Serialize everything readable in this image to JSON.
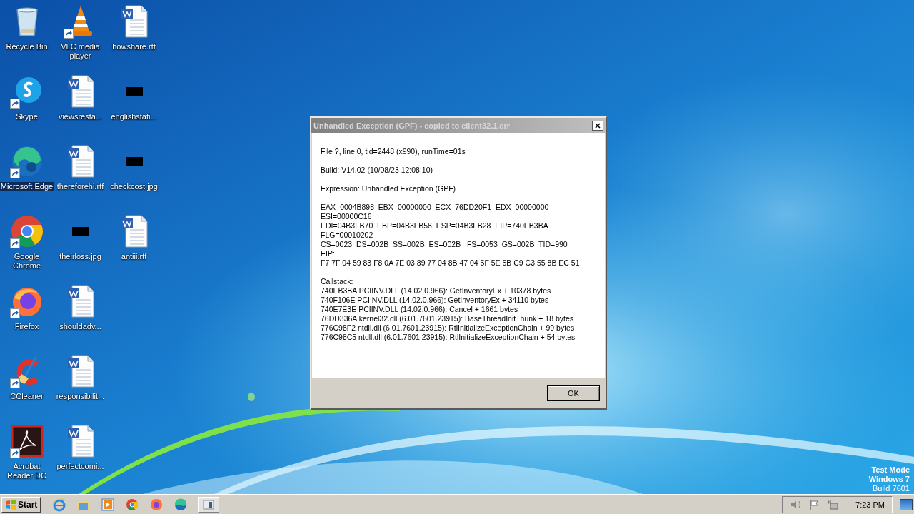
{
  "desktop_icons": [
    {
      "label": "Recycle Bin",
      "kind": "recycle",
      "shortcut": false,
      "selected": false
    },
    {
      "label": "Skype",
      "kind": "skype",
      "shortcut": true,
      "selected": false
    },
    {
      "label": "Microsoft Edge",
      "kind": "edge",
      "shortcut": true,
      "selected": true
    },
    {
      "label": "Google Chrome",
      "kind": "chrome",
      "shortcut": true,
      "selected": false
    },
    {
      "label": "Firefox",
      "kind": "firefox",
      "shortcut": true,
      "selected": false
    },
    {
      "label": "CCleaner",
      "kind": "ccleaner",
      "shortcut": true,
      "selected": false
    },
    {
      "label": "Acrobat Reader DC",
      "kind": "acrobat",
      "shortcut": true,
      "selected": false
    },
    {
      "label": "VLC media player",
      "kind": "vlc",
      "shortcut": true,
      "selected": false
    },
    {
      "label": "viewsresta...",
      "kind": "word",
      "shortcut": false,
      "selected": false
    },
    {
      "label": "thereforehi.rtf",
      "kind": "word",
      "shortcut": false,
      "selected": false
    },
    {
      "label": "theirloss.jpg",
      "shortcut": false,
      "selected": false
    },
    {
      "label": "shouldadv...",
      "kind": "word",
      "shortcut": false,
      "selected": false
    },
    {
      "label": "responsibilit...",
      "kind": "word",
      "shortcut": false,
      "selected": false
    },
    {
      "label": "perfectcomi...",
      "kind": "word",
      "shortcut": false,
      "selected": false
    },
    {
      "label": "howshare.rtf",
      "kind": "word",
      "shortcut": false,
      "selected": false
    },
    {
      "label": "englishstati...",
      "shortcut": false,
      "selected": false
    },
    {
      "label": "checkcost.jpg",
      "shortcut": false,
      "selected": false
    },
    {
      "label": "antiii.rtf",
      "kind": "word",
      "shortcut": false,
      "selected": false
    }
  ],
  "dialog": {
    "title": "Unhandled Exception (GPF) - copied to client32.1.err",
    "paragraphs": [
      [
        "File ?, line 0, tid=2448 (x990), runTime=01s"
      ],
      [
        "Build: V14.02 (10/08/23 12:08:10)"
      ],
      [
        "Expression: Unhandled Exception (GPF)"
      ],
      [
        "EAX=0004B898  EBX=00000000  ECX=76DD20F1  EDX=00000000",
        "ESI=00000C16",
        "EDI=04B3FB70  EBP=04B3FB58  ESP=04B3FB28  EIP=740EB3BA",
        "FLG=00010202",
        "CS=0023  DS=002B  SS=002B  ES=002B   FS=0053  GS=002B  TID=990",
        "EIP:",
        "F7 7F 04 59 83 F8 0A 7E 03 89 77 04 8B 47 04 5F 5E 5B C9 C3 55 8B EC 51"
      ],
      [
        "Callstack:",
        "740EB3BA PCIINV.DLL (14.02.0.966): GetInventoryEx + 10378 bytes",
        "740F106E PCIINV.DLL (14.02.0.966): GetInventoryEx + 34110 bytes",
        "740E7E3E PCIINV.DLL (14.02.0.966): Cancel + 1661 bytes",
        "76DD336A kernel32.dll (6.01.7601.23915): BaseThreadInitThunk + 18 bytes",
        "776C98F2 ntdll.dll (6.01.7601.23915): RtlInitializeExceptionChain + 99 bytes",
        "776C98C5 ntdll.dll (6.01.7601.23915): RtlInitializeExceptionChain + 54 bytes"
      ]
    ],
    "buttons": [
      "OK"
    ]
  },
  "os_notice": [
    "Test Mode",
    "Windows 7",
    "Build 7601"
  ],
  "taskbar": {
    "start": "Start",
    "apps": [
      {
        "kind": "ie"
      },
      {
        "kind": "explorer"
      },
      {
        "kind": "media"
      },
      {
        "kind": "chrome"
      },
      {
        "kind": "firefox"
      },
      {
        "kind": "edge"
      },
      {
        "kind": "window"
      }
    ],
    "tray": [
      {
        "kind": "speaker"
      },
      {
        "kind": "flag"
      },
      {
        "kind": "network"
      }
    ],
    "clock": "7:23 PM"
  }
}
